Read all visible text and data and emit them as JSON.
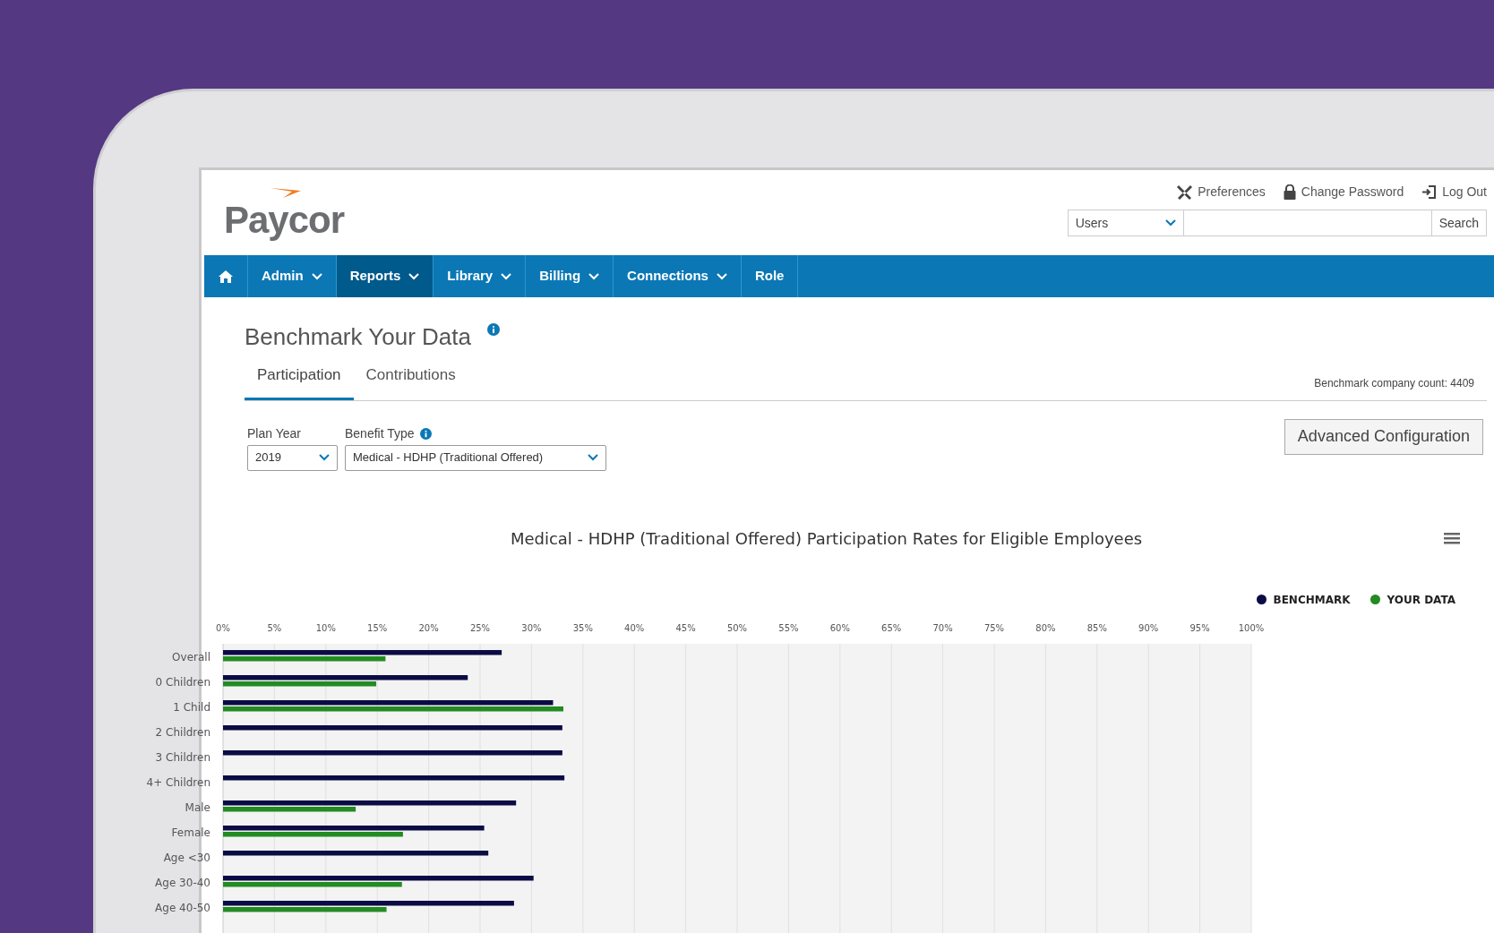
{
  "header": {
    "logo": "Paycor",
    "links": [
      {
        "kind": "tools",
        "label": "Preferences"
      },
      {
        "kind": "lock",
        "label": "Change Password"
      },
      {
        "kind": "exit",
        "label": "Log Out"
      }
    ],
    "search": {
      "scope": "Users",
      "button": "Search"
    }
  },
  "nav": [
    {
      "kind": "home",
      "selected": false
    },
    {
      "kind": "menu",
      "label": "Admin",
      "dropdown": true,
      "selected": false
    },
    {
      "kind": "menu",
      "label": "Reports",
      "dropdown": true,
      "selected": true
    },
    {
      "kind": "menu",
      "label": "Library",
      "dropdown": true,
      "selected": false
    },
    {
      "kind": "menu",
      "label": "Billing",
      "dropdown": true,
      "selected": false
    },
    {
      "kind": "menu",
      "label": "Connections",
      "dropdown": true,
      "selected": false
    },
    {
      "kind": "menu",
      "label": "Role",
      "dropdown": false,
      "selected": false
    }
  ],
  "page": {
    "title": "Benchmark Your Data",
    "tabs": [
      {
        "label": "Participation",
        "selected": true
      },
      {
        "label": "Contributions",
        "selected": false
      }
    ],
    "company_count": "Benchmark company count: 4409",
    "filters": [
      {
        "label": "Plan Year",
        "value": "2019",
        "info": false
      },
      {
        "label": "Benefit Type",
        "value": "Medical - HDHP (Traditional Offered)",
        "info": true
      }
    ],
    "advanced_button": "Advanced Configuration"
  },
  "chart": {
    "chart_data": {
      "type": "bar",
      "orientation": "horizontal",
      "title": "Medical - HDHP (Traditional Offered) Participation Rates for Eligible Employees",
      "categories": [
        "Overall",
        "0 Children",
        "1 Child",
        "2 Children",
        "3 Children",
        "4+ Children",
        "Male",
        "Female",
        "Age <30",
        "Age 30-40",
        "Age 40-50"
      ],
      "grid": true,
      "series": [
        {
          "name": "BENCHMARK",
          "color": "#0b0b45",
          "values": [
            27.1,
            23.8,
            32.1,
            33.0,
            33.0,
            33.2,
            28.5,
            25.4,
            25.8,
            30.2,
            28.3
          ]
        },
        {
          "name": "YOUR DATA",
          "color": "#228b22",
          "values": [
            15.8,
            14.9,
            33.1,
            null,
            null,
            null,
            12.9,
            17.5,
            null,
            17.4,
            15.9
          ]
        }
      ],
      "xlim": [
        0,
        100
      ],
      "xticks": [
        {
          "value": 0,
          "label": "0%"
        },
        {
          "value": 5,
          "label": "5%"
        },
        {
          "value": 10,
          "label": "10%"
        },
        {
          "value": 15,
          "label": "15%"
        },
        {
          "value": 20,
          "label": "20%"
        },
        {
          "value": 25,
          "label": "25%"
        },
        {
          "value": 30,
          "label": "30%"
        },
        {
          "value": 35,
          "label": "35%"
        },
        {
          "value": 40,
          "label": "40%"
        },
        {
          "value": 45,
          "label": "45%"
        },
        {
          "value": 50,
          "label": "50%"
        },
        {
          "value": 55,
          "label": "55%"
        },
        {
          "value": 60,
          "label": "60%"
        },
        {
          "value": 65,
          "label": "65%"
        },
        {
          "value": 70,
          "label": "70%"
        },
        {
          "value": 75,
          "label": "75%"
        },
        {
          "value": 80,
          "label": "80%"
        },
        {
          "value": 85,
          "label": "85%"
        },
        {
          "value": 90,
          "label": "90%"
        },
        {
          "value": 95,
          "label": "95%"
        },
        {
          "value": 100,
          "label": "100%"
        }
      ]
    }
  }
}
